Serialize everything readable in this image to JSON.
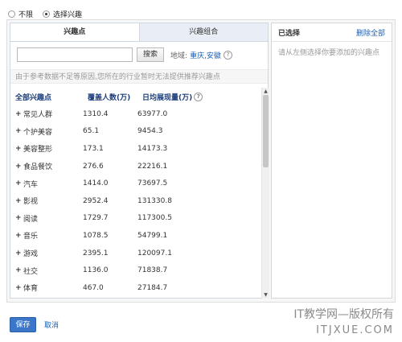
{
  "radio_options": {
    "unlimited": "不限",
    "select_interest": "选择兴趣"
  },
  "tabs": [
    {
      "label": "兴趣点"
    },
    {
      "label": "兴趣组合"
    }
  ],
  "search": {
    "placeholder": "",
    "button_label": "搜索",
    "region_label": "地域:",
    "region_value": "重庆,安徽"
  },
  "notice": "由于参考数据不足等原因,您所在的行业暂时无法提供推荐兴趣点",
  "table": {
    "headers": {
      "name": "全部兴趣点",
      "cover": "覆盖人数(万)",
      "impressions": "日均展现量(万)"
    },
    "rows": [
      {
        "name": "常见人群",
        "cover": "1310.4",
        "impressions": "63977.0"
      },
      {
        "name": "个护美容",
        "cover": "65.1",
        "impressions": "9454.3"
      },
      {
        "name": "美容整形",
        "cover": "173.1",
        "impressions": "14173.3"
      },
      {
        "name": "食品餐饮",
        "cover": "276.6",
        "impressions": "22216.1"
      },
      {
        "name": "汽车",
        "cover": "1414.0",
        "impressions": "73697.5"
      },
      {
        "name": "影视",
        "cover": "2952.4",
        "impressions": "131330.8"
      },
      {
        "name": "阅读",
        "cover": "1729.7",
        "impressions": "117300.5"
      },
      {
        "name": "音乐",
        "cover": "1078.5",
        "impressions": "54799.1"
      },
      {
        "name": "游戏",
        "cover": "2395.1",
        "impressions": "120097.1"
      },
      {
        "name": "社交",
        "cover": "1136.0",
        "impressions": "71838.7"
      },
      {
        "name": "体育",
        "cover": "467.0",
        "impressions": "27184.7"
      }
    ]
  },
  "right_panel": {
    "title": "已选择",
    "remove_all": "删除全部",
    "hint": "请从左侧选择你要添加的兴趣点"
  },
  "footer": {
    "save": "保存",
    "cancel": "取消"
  },
  "watermark": {
    "line1": "IT教学网—版权所有",
    "line2": "ITJXUE.COM"
  },
  "colors": {
    "link": "#1b5fb4",
    "save_button": "#3b76c8",
    "header_text": "#1b3d7a"
  },
  "icons": {
    "expand": "plus-icon",
    "help": "help-icon"
  }
}
